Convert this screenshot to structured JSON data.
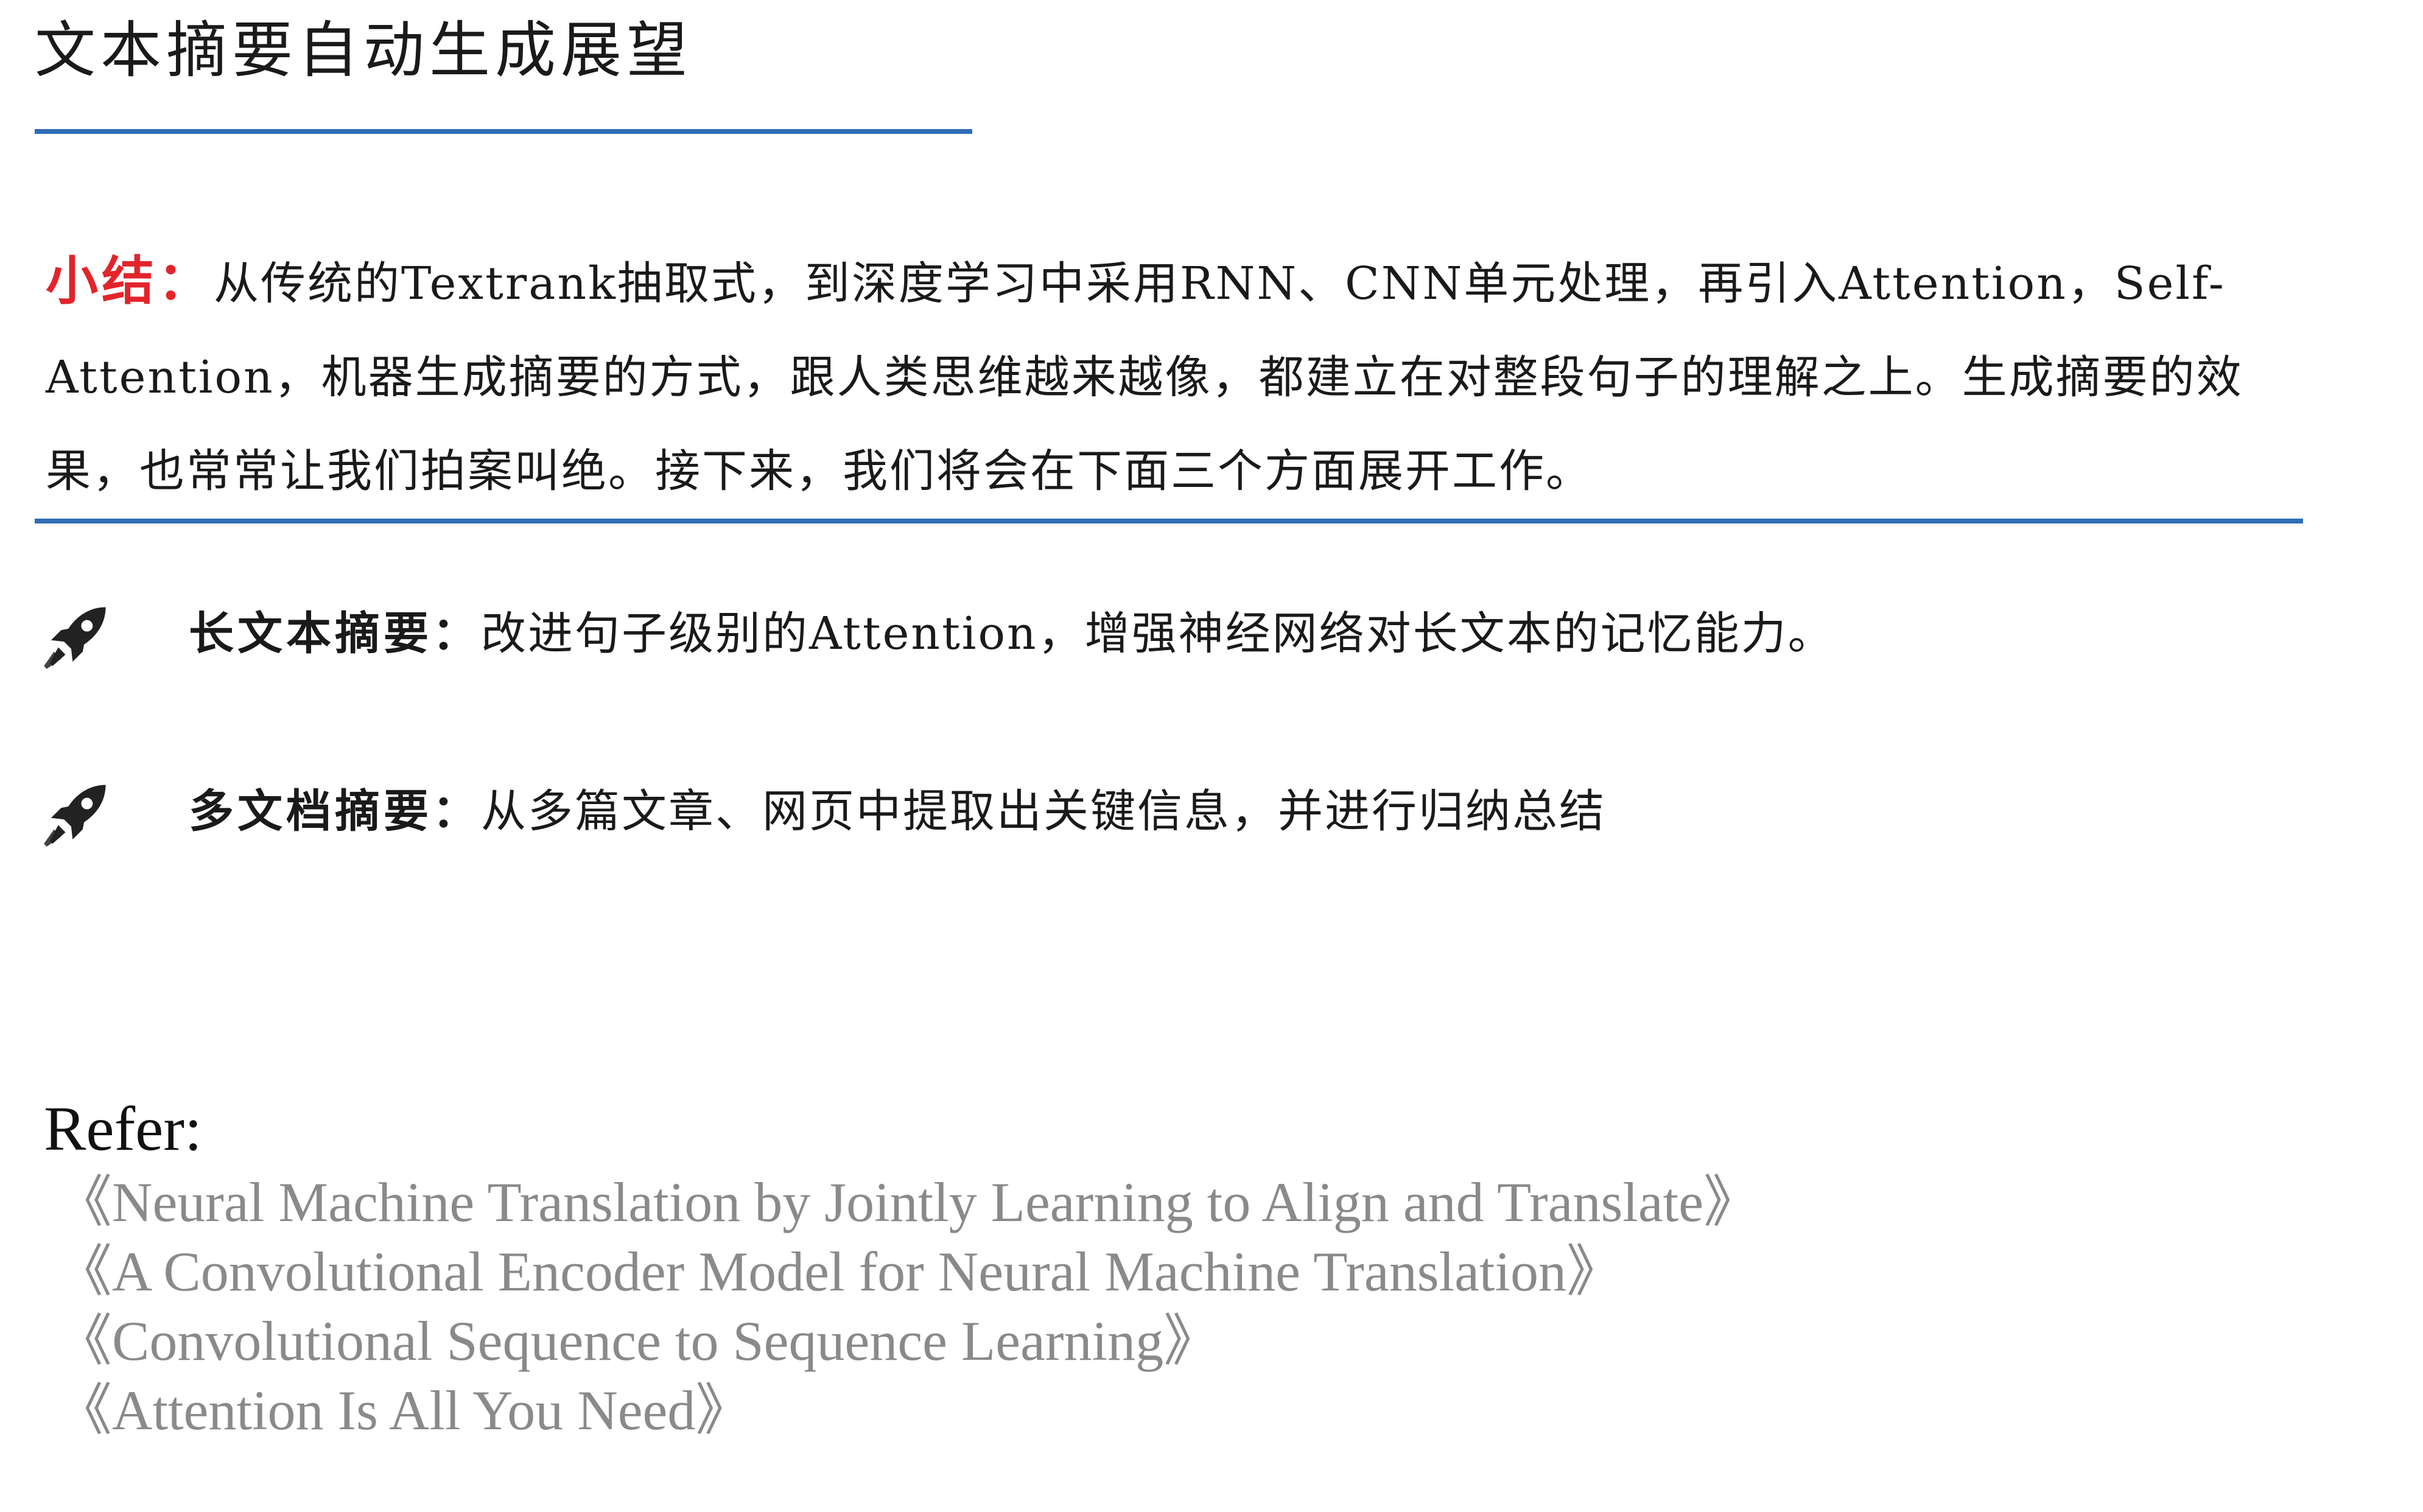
{
  "title": "文本摘要自动生成展望",
  "summary": {
    "label": "小结：",
    "text": "从传统的Textrank抽取式，到深度学习中采用RNN、CNN单元处理，再引入Attention，Self-Attention，机器生成摘要的方式，跟人类思维越来越像，都建立在对整段句子的理解之上。生成摘要的效果，也常常让我们拍案叫绝。接下来，我们将会在下面三个方面展开工作。"
  },
  "points": [
    {
      "icon": "rocket-icon",
      "title": "长文本摘要：",
      "text": "改进句子级别的Attention，增强神经网络对长文本的记忆能力。"
    },
    {
      "icon": "rocket-icon",
      "title": "多文档摘要：",
      "text": "从多篇文章、网页中提取出关键信息，并进行归纳总结"
    }
  ],
  "refer": {
    "heading": "Refer:",
    "items": [
      "《Neural Machine Translation by Jointly Learning to Align and Translate》",
      "《A Convolutional Encoder Model for Neural Machine Translation》",
      "《Convolutional Sequence to Sequence Learning》",
      "《Attention Is All You Need》"
    ]
  },
  "colors": {
    "accent_rule": "#2f6db5",
    "summary_label": "#e3242b",
    "reference_text": "#8a8a8a"
  }
}
